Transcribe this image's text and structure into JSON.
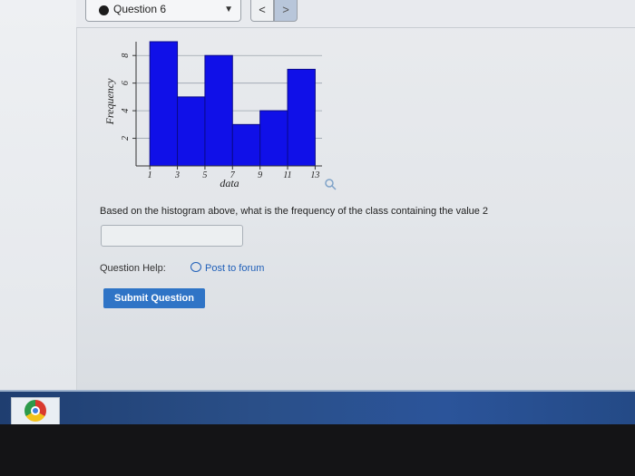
{
  "header": {
    "question_select": "Question 6",
    "prev_label": "<",
    "next_label": ">"
  },
  "chart_data": {
    "type": "bar",
    "xlabel": "data",
    "ylabel": "Frequency",
    "x_ticks": [
      "1",
      "3",
      "5",
      "7",
      "9",
      "11",
      "13"
    ],
    "y_ticks": [
      "2",
      "4",
      "6",
      "8"
    ],
    "bins": [
      {
        "start": 1,
        "end": 3,
        "value": 9
      },
      {
        "start": 3,
        "end": 5,
        "value": 5
      },
      {
        "start": 5,
        "end": 7,
        "value": 8
      },
      {
        "start": 7,
        "end": 9,
        "value": 3
      },
      {
        "start": 9,
        "end": 11,
        "value": 4
      },
      {
        "start": 11,
        "end": 13,
        "value": 7
      }
    ],
    "xlim": [
      0,
      13.5
    ],
    "ylim": [
      0,
      9
    ],
    "grid": true,
    "bar_color": "#1010e8"
  },
  "question": {
    "prompt": "Based on the histogram above, what is the frequency of the class containing the value 2",
    "answer_value": ""
  },
  "help": {
    "label": "Question Help:",
    "forum_link": "Post to forum"
  },
  "submit_label": "Submit Question",
  "icons": {
    "select_dot": "filled-circle-icon",
    "dropdown": "chevron-down-icon",
    "zoom": "magnifier-icon",
    "forum": "speech-bubble-icon",
    "taskbar_app": "chrome-icon"
  }
}
